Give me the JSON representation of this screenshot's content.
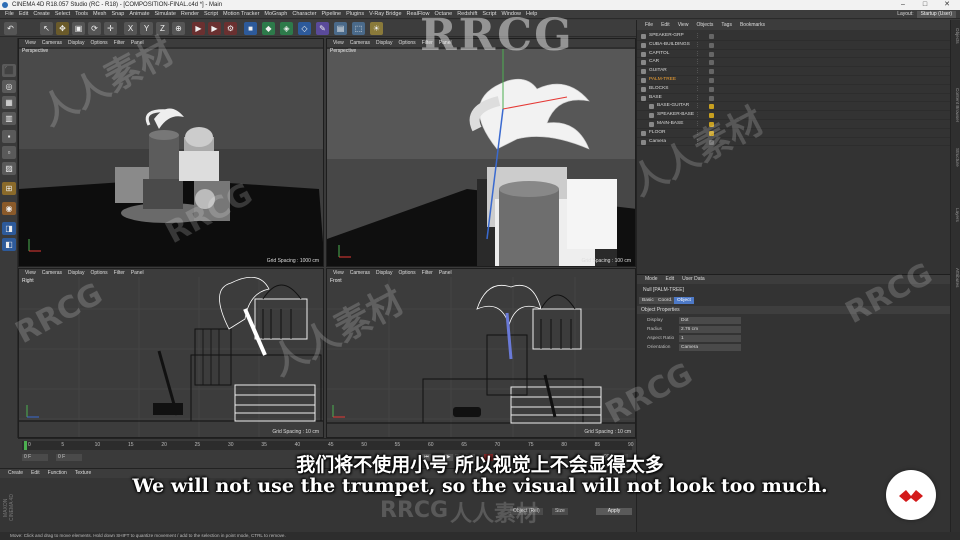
{
  "window": {
    "title": "CINEMA 4D R18.057 Studio (RC - R18) - [COMPOSITION-FINAL.c4d *] - Main"
  },
  "menubar": {
    "items": [
      "File",
      "Edit",
      "Create",
      "Select",
      "Tools",
      "Mesh",
      "Snap",
      "Animate",
      "Simulate",
      "Render",
      "Script",
      "Motion Tracker",
      "MoGraph",
      "Character",
      "Pipeline",
      "Plugins",
      "V-Ray Bridge",
      "RealFlow",
      "Octane",
      "Redshift",
      "Script",
      "Window",
      "Help"
    ]
  },
  "layout": {
    "label": "Layout:",
    "value": "Startup (User)"
  },
  "viewports": {
    "menu": [
      "View",
      "Cameras",
      "Display",
      "Options",
      "Filter",
      "Panel"
    ],
    "top_left": {
      "name": "Perspective",
      "grid": "Grid Spacing : 1000 cm"
    },
    "top_right": {
      "name": "Perspective",
      "grid": "Grid Spacing : 100 cm"
    },
    "bottom_left": {
      "name": "Right",
      "grid": "Grid Spacing : 10 cm"
    },
    "bottom_right": {
      "name": "Front",
      "grid": "Grid Spacing : 10 cm"
    }
  },
  "object_manager": {
    "menu": [
      "File",
      "Edit",
      "View",
      "Objects",
      "Tags",
      "Bookmarks"
    ],
    "objects": [
      {
        "name": "SPEAKER-GRP",
        "indent": 0,
        "color": "#dcdcdc"
      },
      {
        "name": "CUBA-BUILDINGS",
        "indent": 0,
        "color": "#dcdcdc"
      },
      {
        "name": "CAPITOL",
        "indent": 0,
        "color": "#dcdcdc"
      },
      {
        "name": "CAR",
        "indent": 0,
        "color": "#dcdcdc"
      },
      {
        "name": "GUITAR",
        "indent": 0,
        "color": "#dcdcdc"
      },
      {
        "name": "PALM-TREE",
        "indent": 0,
        "color": "#f0a030"
      },
      {
        "name": "BLOCKS",
        "indent": 0,
        "color": "#dcdcdc"
      },
      {
        "name": "BASE",
        "indent": 0,
        "color": "#dcdcdc"
      },
      {
        "name": "BASE-GUITAR",
        "indent": 1,
        "color": "#dcdcdc"
      },
      {
        "name": "SPEAKER-BASE",
        "indent": 1,
        "color": "#dcdcdc"
      },
      {
        "name": "MAIN-BASE",
        "indent": 1,
        "color": "#dcdcdc"
      },
      {
        "name": "FLOOR",
        "indent": 0,
        "color": "#dcdcdc"
      },
      {
        "name": "Camera",
        "indent": 0,
        "color": "#dcdcdc"
      }
    ]
  },
  "attributes": {
    "menu": [
      "Mode",
      "Edit",
      "User Data"
    ],
    "title": "Null [PALM-TREE]",
    "tabs": [
      "Basic",
      "Coord.",
      "Object"
    ],
    "active_tab": "Object",
    "section": "Object Properties",
    "fields": [
      {
        "label": "Display",
        "value": "Dot"
      },
      {
        "label": "Radius",
        "value": "2.76 cm"
      },
      {
        "label": "Aspect Ratio",
        "value": "1"
      },
      {
        "label": "Orientation",
        "value": "Camera"
      }
    ]
  },
  "side_tabs": [
    "Objects",
    "Content Browser",
    "Structure",
    "Layers",
    "Attributes"
  ],
  "timeline": {
    "ticks": [
      "0",
      "5",
      "10",
      "15",
      "20",
      "25",
      "30",
      "35",
      "40",
      "45",
      "50",
      "55",
      "60",
      "65",
      "70",
      "75",
      "80",
      "85",
      "90"
    ],
    "current_frame": "0 F",
    "start_field": "0 F",
    "end_field": "90 F"
  },
  "material_manager": {
    "menu": [
      "Create",
      "Edit",
      "Function",
      "Texture"
    ],
    "brand": "MAXON CINEMA 4D"
  },
  "coordinates": {
    "mode1": "Object (Rel)",
    "mode2": "Size",
    "apply": "Apply",
    "h_value": "0 °"
  },
  "status_bar": "Move: Click and drag to move elements. Hold down SHIFT to quantize movement / add to the selection in point mode, CTRL to remove.",
  "subtitles": {
    "cn": "我们将不使用小号 所以视觉上不会显得太多",
    "en": "We will not use the trumpet, so the visual will not look too much."
  },
  "watermarks": {
    "logo": "RRCG",
    "cn": "人人素材"
  },
  "colors": {
    "accent": "#4d79c7",
    "selected": "#f0a030",
    "playhead": "#4caf50",
    "badge": "#d31a1a"
  }
}
